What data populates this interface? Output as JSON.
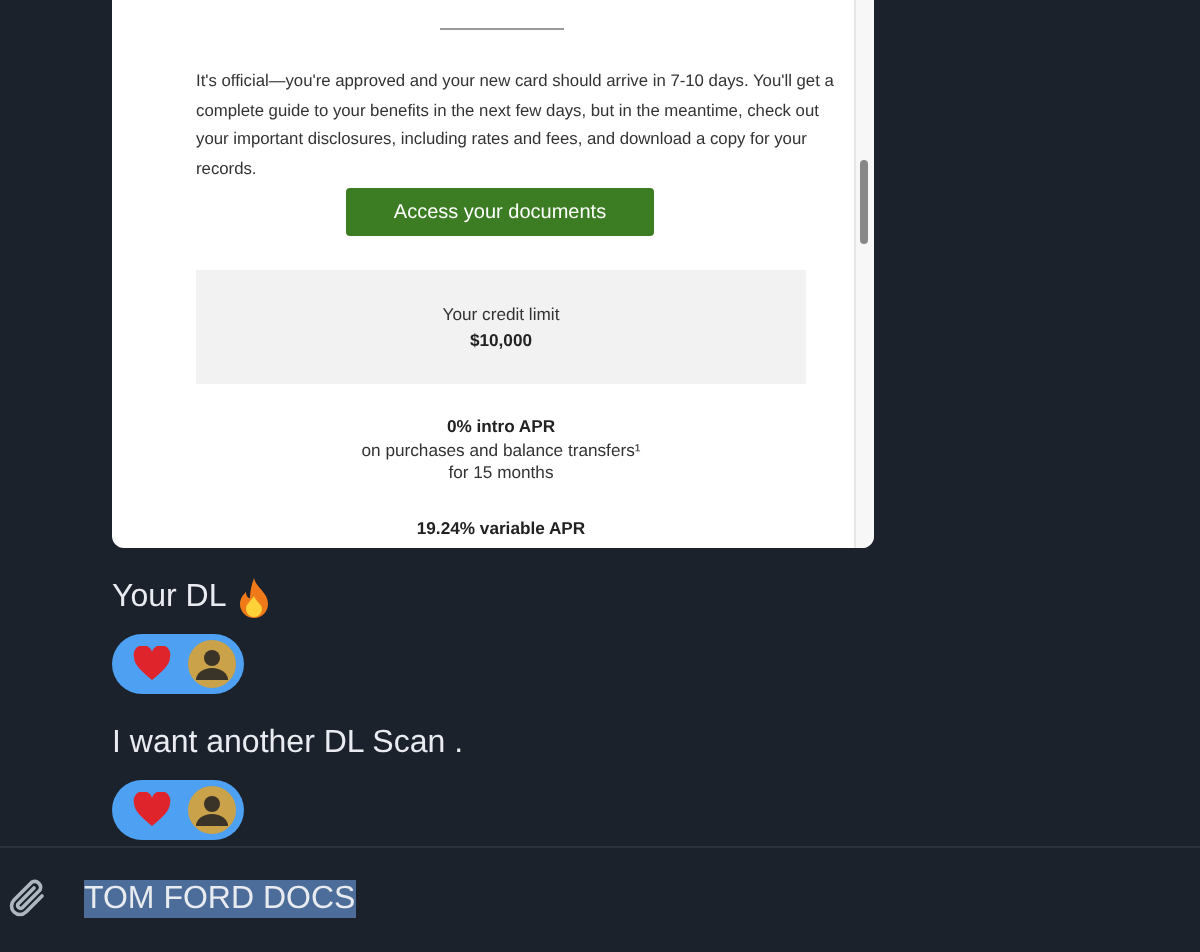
{
  "email_preview": {
    "paragraph": "It's official—you're approved and your new card should arrive in 7-10 days. You'll get a complete guide to your benefits in the next few days, but in the meantime, check out your important disclosures, including rates and fees, and download a copy for your records.",
    "button": "Access your documents",
    "credit_limit": {
      "label": "Your credit limit",
      "value": "$10,000"
    },
    "offers": [
      {
        "title": "0% intro APR",
        "lines": [
          "on purchases and balance transfers¹",
          "for 15 months"
        ]
      },
      {
        "title": "19.24% variable APR"
      }
    ]
  },
  "messages": [
    {
      "text": "Your DL",
      "fire": true,
      "reactions": [
        {
          "kind": "heart"
        },
        {
          "kind": "avatar"
        }
      ]
    },
    {
      "text": "I want another DL Scan .",
      "reactions": [
        {
          "kind": "heart"
        },
        {
          "kind": "avatar"
        }
      ]
    }
  ],
  "composer": {
    "value": "TOM FORD DOCS",
    "selected": true
  }
}
